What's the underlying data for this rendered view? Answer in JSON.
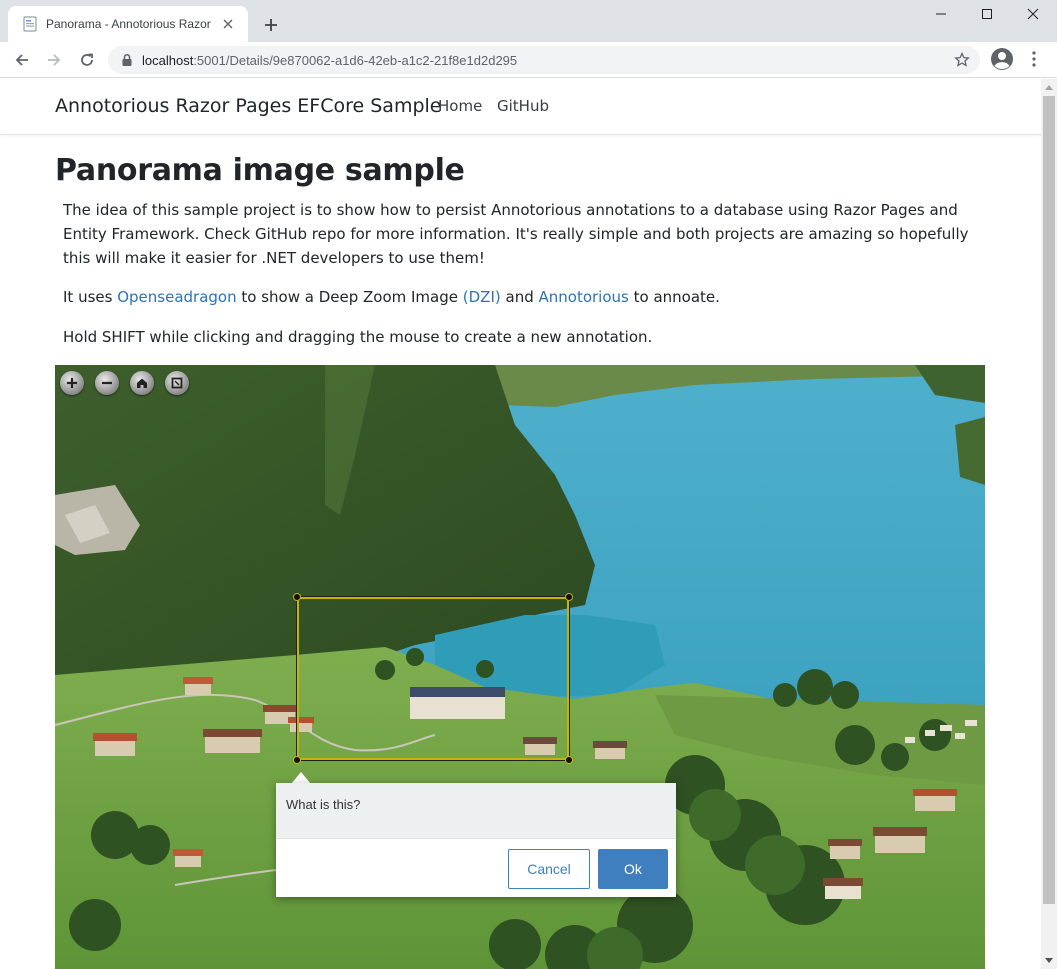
{
  "browser": {
    "tab_title": "Panorama - Annotorious Razor P",
    "url_host": "localhost",
    "url_rest": ":5001/Details/9e870062-a1d6-42eb-a1c2-21f8e1d2d295"
  },
  "site": {
    "brand": "Annotorious Razor Pages EFCore Sample",
    "nav": [
      "Home",
      "GitHub"
    ]
  },
  "page": {
    "title": "Panorama image sample",
    "intro": "The idea of this sample project is to show how to persist Annotorious annotations to a database using Razor Pages and Entity Framework. Check GitHub repo for more information. It's really simple and both projects are amazing so hopefully this will make it easier for .NET developers to use them!",
    "uses_prefix": "It uses ",
    "link_openseadragon": "Openseadragon",
    "uses_mid1": " to show a Deep Zoom Image ",
    "link_dzi": "(DZI)",
    "uses_mid2": " and ",
    "link_annotorious": "Annotorious",
    "uses_suffix": " to annoate.",
    "hint": "Hold SHIFT while clicking and dragging the mouse to create a new annotation."
  },
  "viewer": {
    "controls": [
      "zoom-in-icon",
      "zoom-out-icon",
      "home-icon",
      "fullscreen-icon"
    ],
    "editor": {
      "comment_placeholder": "What is this?",
      "cancel_label": "Cancel",
      "ok_label": "Ok"
    }
  },
  "colors": {
    "accent": "#3f7fbf",
    "link": "#2c73b7",
    "annotation_border": "#c8b400"
  }
}
